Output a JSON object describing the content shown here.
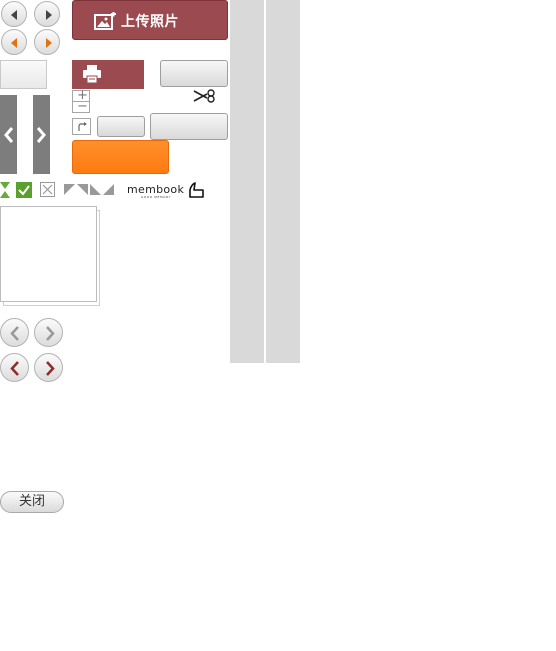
{
  "upload": {
    "label": "上传照片"
  },
  "close": {
    "label": "关闭"
  },
  "zoom": {
    "plus": "+",
    "minus": "−"
  },
  "logo": {
    "text": "membook",
    "sub": "GOOD MEMORY"
  },
  "icons": {
    "upload": "image-add-icon",
    "print": "printer-icon",
    "scissors": "scissors-icon",
    "check": "checkmark-icon",
    "cross": "cross-box-icon",
    "rotate": "rotate-icon"
  },
  "colors": {
    "brand_red": "#9b4a4f",
    "orange": "#ff8220",
    "arrow_orange": "#e0720f",
    "check_green": "#5aa02c",
    "grey_side": "#7d7d7d",
    "column_grey": "#d9d9d9"
  }
}
